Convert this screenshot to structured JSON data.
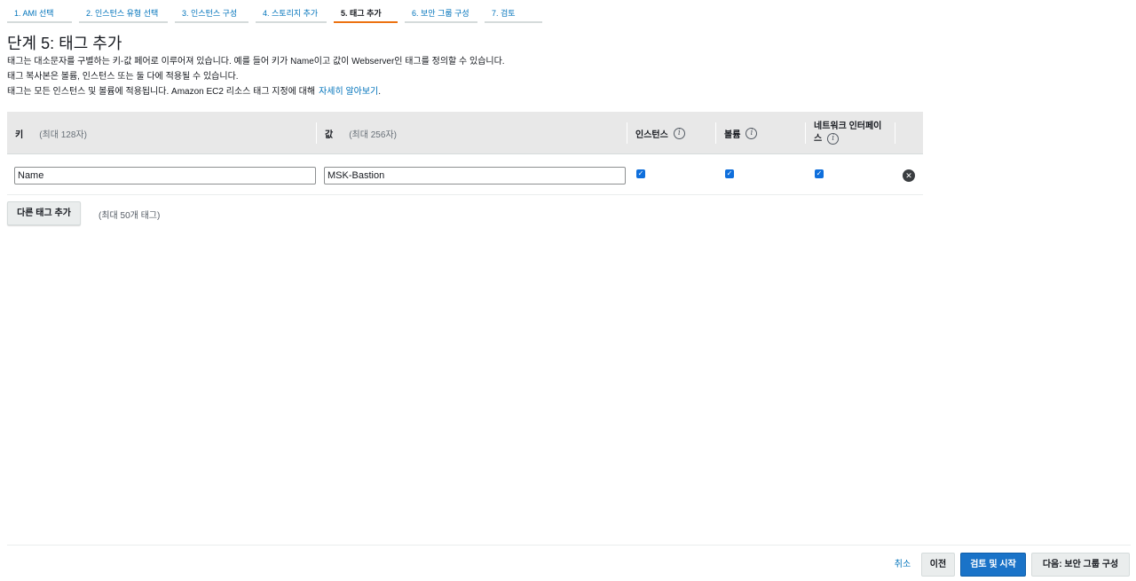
{
  "wizard": {
    "steps": [
      {
        "label": "1. AMI 선택"
      },
      {
        "label": "2. 인스턴스 유형 선택"
      },
      {
        "label": "3. 인스턴스 구성"
      },
      {
        "label": "4. 스토리지 추가"
      },
      {
        "label": "5. 태그 추가"
      },
      {
        "label": "6. 보안 그룹 구성"
      },
      {
        "label": "7. 검토"
      }
    ],
    "active_step": "5. 태그 추가"
  },
  "page": {
    "title": "단계 5: 태그 추가",
    "desc1": "태그는 대소문자를 구별하는 키-값 페어로 이루어져 있습니다. 예를 들어 키가 Name이고 값이 Webserver인 태그를 정의할 수 있습니다.",
    "desc2": "태그 복사본은 볼륨, 인스턴스 또는 둘 다에 적용될 수 있습니다.",
    "desc3": "태그는 모든 인스턴스 및 볼륨에 적용됩니다. Amazon EC2 리소스 태그 지정에 대해",
    "learn_more": "자세히 알아보기",
    "desc3_end": "."
  },
  "table": {
    "headers": {
      "key": "키",
      "key_hint": "(최대 128자)",
      "value": "값",
      "value_hint": "(최대 256자)",
      "instances": "인스턴스",
      "volumes": "볼륨",
      "network_interfaces_line1": "네트워크 인터페이",
      "network_interfaces_line2": "스"
    },
    "rows": [
      {
        "key": "Name",
        "value": "MSK-Bastion",
        "instances": true,
        "volumes": true,
        "network_interfaces": true
      }
    ]
  },
  "add_tag": {
    "button_label": "다른 태그 추가",
    "limit_note": "(최대 50개 태그)"
  },
  "footer": {
    "cancel": "취소",
    "previous": "이전",
    "review_launch": "검토 및 시작",
    "next": "다음: 보안 그룹 구성"
  },
  "colors": {
    "accent": "#ec7211",
    "link": "#0073bb",
    "primary_button": "#1a73c8",
    "checkbox": "#0f6fdc"
  },
  "icons": {
    "info": "info-icon",
    "remove": "remove-tag-icon",
    "checkbox": "checkbox-checked"
  }
}
